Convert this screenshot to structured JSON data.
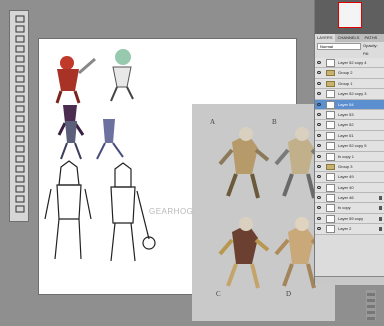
{
  "toolbox": {
    "tool_icons": [
      "move-icon",
      "marquee-icon",
      "lasso-icon",
      "quick-select-icon",
      "crop-icon",
      "eyedropper-icon",
      "heal-icon",
      "brush-icon",
      "stamp-icon",
      "history-brush-icon",
      "eraser-icon",
      "gradient-icon",
      "blur-icon",
      "dodge-icon",
      "pen-icon",
      "type-icon",
      "path-select-icon",
      "shape-icon",
      "hand-icon",
      "zoom-icon"
    ]
  },
  "canvas": {
    "labels": [
      "A",
      "B",
      "C",
      "D"
    ],
    "watermark": "GEARHOG"
  },
  "panel": {
    "tabs": [
      "LAYERS",
      "CHANNELS",
      "PATHS"
    ],
    "blend_mode": "Normal",
    "opacity_label": "Opacity:",
    "fill_label": "Fill:",
    "layers": [
      {
        "name": "Layer 52 copy 4",
        "type": "layer",
        "selected": false
      },
      {
        "name": "Group 2",
        "type": "folder",
        "selected": false
      },
      {
        "name": "Group 1",
        "type": "folder",
        "selected": false
      },
      {
        "name": "Layer 52 copy 3",
        "type": "layer",
        "selected": false
      },
      {
        "name": "Layer 54",
        "type": "layer",
        "selected": true
      },
      {
        "name": "Layer 53",
        "type": "layer",
        "selected": false
      },
      {
        "name": "Layer 52",
        "type": "layer",
        "selected": false
      },
      {
        "name": "Layer 51",
        "type": "layer",
        "selected": false
      },
      {
        "name": "Layer 52 copy 5",
        "type": "layer",
        "selected": false
      },
      {
        "name": "fx copy 1",
        "type": "layer",
        "selected": false
      },
      {
        "name": "Group 3",
        "type": "folder",
        "selected": false
      },
      {
        "name": "Layer 49",
        "type": "layer",
        "selected": false
      },
      {
        "name": "Layer 40",
        "type": "layer",
        "selected": false
      },
      {
        "name": "Layer 46",
        "type": "layer",
        "selected": false
      },
      {
        "name": "fx copy",
        "type": "layer",
        "selected": false
      },
      {
        "name": "Layer 59 copy",
        "type": "layer",
        "selected": false
      },
      {
        "name": "Layer 2",
        "type": "layer",
        "selected": false
      }
    ]
  }
}
